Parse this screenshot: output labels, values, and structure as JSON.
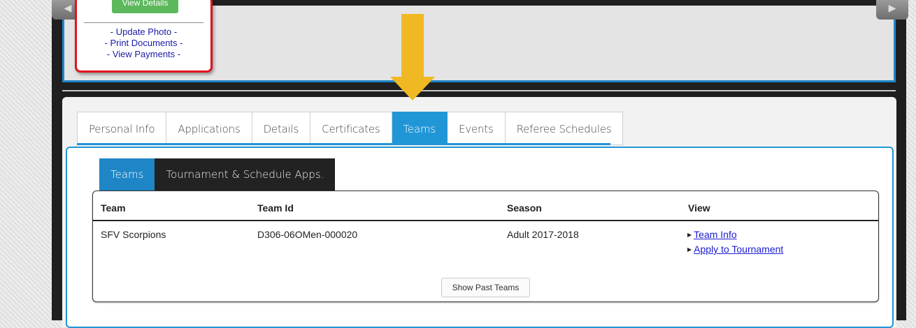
{
  "profile_card": {
    "view_details_label": "View Details",
    "links": [
      "- Update Photo -",
      "- Print Documents -",
      "- View Payments -"
    ]
  },
  "tabs": [
    {
      "label": "Personal Info",
      "active": false
    },
    {
      "label": "Applications",
      "active": false
    },
    {
      "label": "Details",
      "active": false
    },
    {
      "label": "Certificates",
      "active": false
    },
    {
      "label": "Teams",
      "active": true
    },
    {
      "label": "Events",
      "active": false
    },
    {
      "label": "Referee Schedules",
      "active": false
    }
  ],
  "subtabs": [
    {
      "label": "Teams",
      "active": true
    },
    {
      "label": "Tournament & Schedule Apps.",
      "active": false
    }
  ],
  "table": {
    "headers": {
      "team": "Team",
      "team_id": "Team Id",
      "season": "Season",
      "view": "View"
    },
    "rows": [
      {
        "team": "SFV Scorpions",
        "team_id": "D306-06OMen-000020",
        "season": "Adult 2017-2018",
        "view_links": [
          "Team Info",
          "Apply to Tournament"
        ]
      }
    ]
  },
  "show_past_teams_label": "Show Past Teams",
  "colors": {
    "accent_blue": "#2196d6",
    "arrow_yellow": "#f0b822",
    "card_border_red": "#e0141e",
    "details_green": "#5cb85c"
  }
}
